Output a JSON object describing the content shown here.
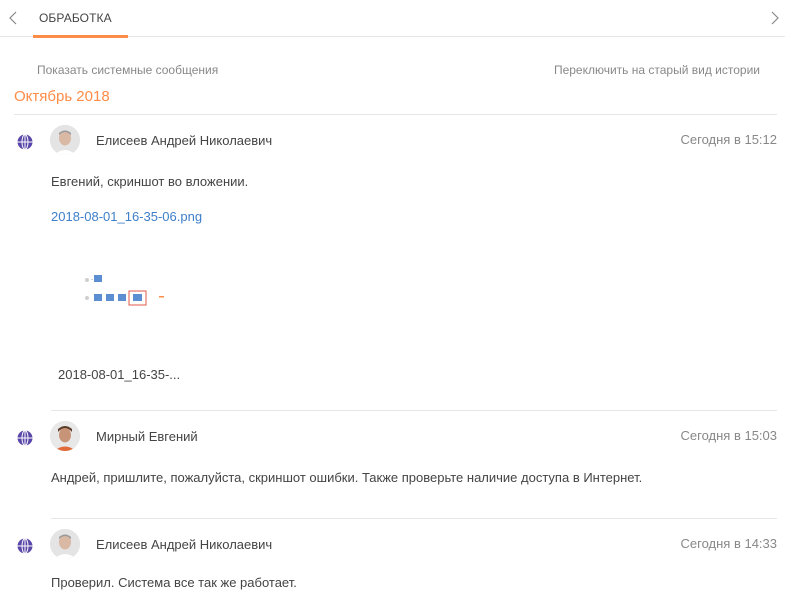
{
  "tabs": {
    "active_label": "ОБРАБОТКА"
  },
  "feed": {
    "show_system_link": "Показать системные сообщения",
    "switch_view_link": "Переключить на старый вид истории",
    "month": "Октябрь 2018"
  },
  "messages": [
    {
      "author": "Елисеев Андрей Николаевич",
      "time": "Сегодня в 15:12",
      "text": "Евгений, скриншот во вложении.",
      "attachment_name": "2018-08-01_16-35-06.png",
      "attachment_caption": "2018-08-01_16-35-..."
    },
    {
      "author": "Мирный Евгений",
      "time": "Сегодня в 15:03",
      "text": "Андрей, пришлите, пожалуйста, скриншот ошибки. Также проверьте наличие доступа в Интернет."
    },
    {
      "author": "Елисеев Андрей Николаевич",
      "time": "Сегодня в 14:33",
      "text": "Проверил. Система все так же работает."
    }
  ],
  "colors": {
    "accent": "#ff8c48",
    "link": "#3d7fc9",
    "globe": "#5a48a8",
    "muted": "#888888"
  },
  "icons": {
    "tab_prev": "chevron-left-icon",
    "tab_next": "chevron-right-icon",
    "message_source": "globe-icon"
  }
}
